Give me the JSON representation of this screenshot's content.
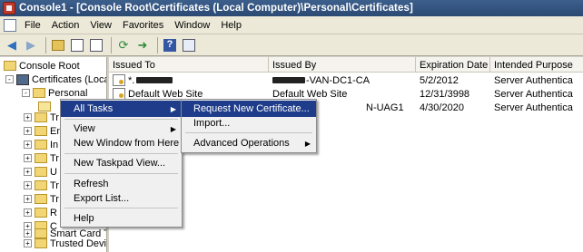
{
  "window": {
    "title": "Console1 - [Console Root\\Certificates (Local Computer)\\Personal\\Certificates]"
  },
  "menubar": {
    "items": [
      "File",
      "Action",
      "View",
      "Favorites",
      "Window",
      "Help"
    ]
  },
  "toolbar": {
    "buttons": [
      "back-icon",
      "forward-icon",
      "up-icon",
      "show-hide-tree-icon",
      "properties-icon",
      "refresh-icon",
      "export-icon",
      "help-icon",
      "snapin-icon"
    ]
  },
  "tree": {
    "items": [
      {
        "label": "Console Root",
        "icon": "folder-icon",
        "expander": ""
      },
      {
        "label": "Certificates (Loca",
        "icon": "computer-icon",
        "expander": "-"
      },
      {
        "label": "Personal",
        "icon": "folder-icon",
        "expander": "-"
      },
      {
        "label": "Tr",
        "icon": "folder-icon",
        "expander": "+"
      },
      {
        "label": "En",
        "icon": "folder-icon",
        "expander": "+"
      },
      {
        "label": "In",
        "icon": "folder-icon",
        "expander": "+"
      },
      {
        "label": "Tr",
        "icon": "folder-icon",
        "expander": "+"
      },
      {
        "label": "U",
        "icon": "folder-icon",
        "expander": "+"
      },
      {
        "label": "Tr",
        "icon": "folder-icon",
        "expander": "+"
      },
      {
        "label": "Tr",
        "icon": "folder-icon",
        "expander": "+"
      },
      {
        "label": "R",
        "icon": "folder-icon",
        "expander": "+"
      },
      {
        "label": "C",
        "icon": "folder-icon",
        "expander": "+"
      },
      {
        "label": "Smart Card Tr",
        "icon": "folder-icon",
        "expander": "+"
      },
      {
        "label": "Trusted Devic",
        "icon": "folder-icon",
        "expander": "+"
      }
    ]
  },
  "list": {
    "columns": [
      "Issued To",
      "Issued By",
      "Expiration Date",
      "Intended Purpose"
    ],
    "rows": [
      {
        "issued_to": "*.",
        "issued_by": "-VAN-DC1-CA",
        "expiration": "5/2/2012",
        "purpose": "Server Authentica"
      },
      {
        "issued_to": "Default Web Site",
        "issued_by": "Default Web Site",
        "expiration": "12/31/3998",
        "purpose": "Server Authentica"
      },
      {
        "issued_to": "",
        "issued_by": "N-UAG1",
        "expiration": "4/30/2020",
        "purpose": "Server Authentica"
      }
    ]
  },
  "context_menu": {
    "items": [
      {
        "label": "All Tasks",
        "submenu": true,
        "highlighted": true
      },
      {
        "label": "View",
        "submenu": true,
        "highlighted": false
      },
      {
        "label": "New Window from Here",
        "submenu": false,
        "highlighted": false
      },
      {
        "label": "New Taskpad View...",
        "submenu": false,
        "highlighted": false
      },
      {
        "label": "Refresh",
        "submenu": false,
        "highlighted": false
      },
      {
        "label": "Export List...",
        "submenu": false,
        "highlighted": false
      },
      {
        "label": "Help",
        "submenu": false,
        "highlighted": false
      }
    ]
  },
  "submenu": {
    "items": [
      {
        "label": "Request New Certificate...",
        "submenu": false,
        "highlighted": true
      },
      {
        "label": "Import...",
        "submenu": false,
        "highlighted": false
      },
      {
        "label": "Advanced Operations",
        "submenu": true,
        "highlighted": false
      }
    ]
  },
  "colors": {
    "titlebar": "#2b4a74",
    "highlight": "#1e3c8a",
    "menu_bg": "#f0f0f0"
  }
}
